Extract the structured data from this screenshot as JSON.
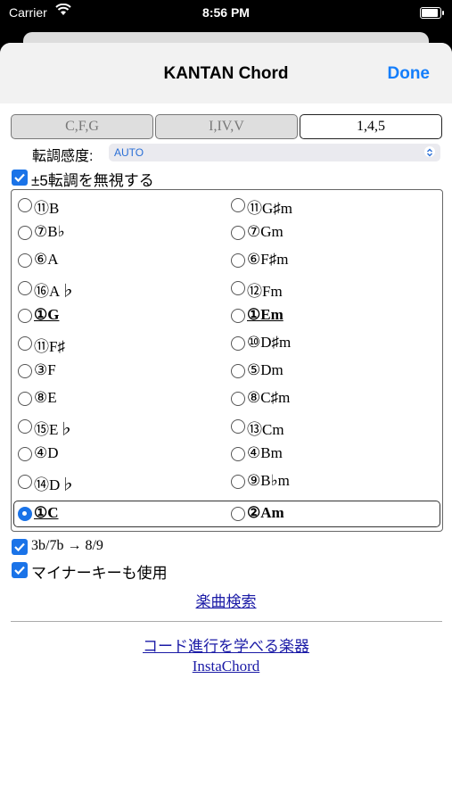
{
  "status_bar": {
    "carrier": "Carrier",
    "time": "8:56 PM"
  },
  "nav": {
    "title": "KANTAN Chord",
    "done": "Done"
  },
  "segments": [
    "C,F,G",
    "I,IV,V",
    "1,4,5"
  ],
  "modulation": {
    "label": "転調感度:",
    "value": "AUTO"
  },
  "ignore_pm5": {
    "label": "±5転調を無視する",
    "checked": true
  },
  "keys_left": [
    "⑪B",
    "⑦B♭",
    "⑥A",
    "⑯A♭",
    "①G",
    "⑪F♯",
    "③F",
    "⑧E",
    "⑮E♭",
    "④D",
    "⑭D♭",
    "①C"
  ],
  "keys_right": [
    "⑪G♯m",
    "⑦Gm",
    "⑥F♯m",
    "⑫Fm",
    "①Em",
    "⑩D♯m",
    "⑤Dm",
    "⑧C♯m",
    "⑬Cm",
    "④Bm",
    "⑨B♭m",
    "②Am"
  ],
  "selected_index": 11,
  "option_3b7b": {
    "label": "3b/7b → 8/9",
    "checked": true
  },
  "option_minor": {
    "label": "マイナーキーも使用",
    "checked": true
  },
  "links": {
    "search": "楽曲検索",
    "instruments": "コード進行を学べる楽器",
    "instachord": "InstaChord"
  },
  "colors": {
    "accent": "#147efb",
    "checkbox": "#1a73e8",
    "link": "#1a1aa6"
  }
}
